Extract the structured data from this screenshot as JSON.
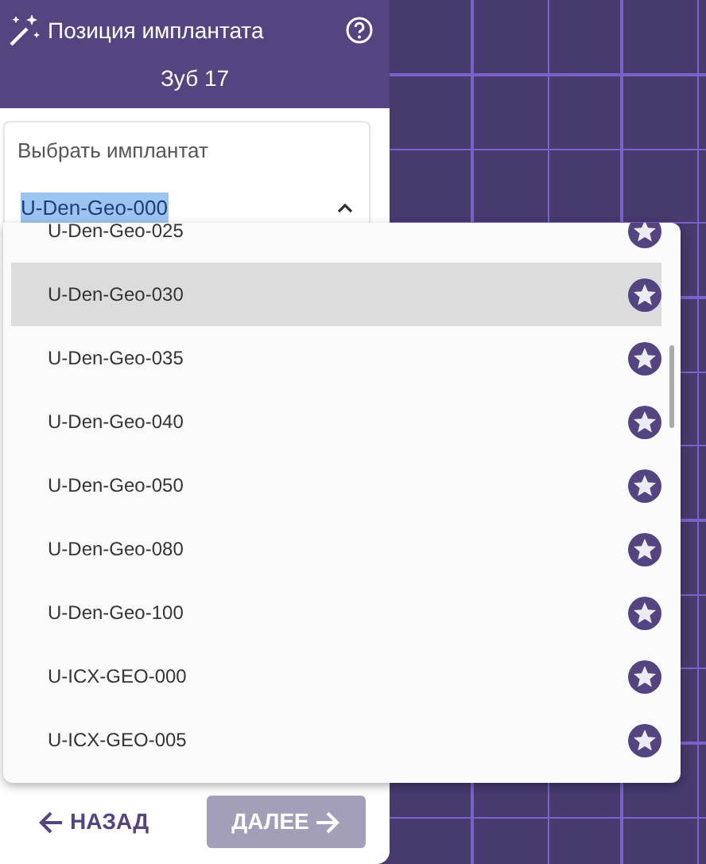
{
  "panel": {
    "title": "Позиция имплантата",
    "subtitle": "Зуб 17"
  },
  "implant_select": {
    "label": "Выбрать имплантат",
    "value": "U-Den-Geo-000",
    "expanded": true
  },
  "dropdown": {
    "items": [
      {
        "label": "U-Den-Geo-025",
        "highlighted": false
      },
      {
        "label": "U-Den-Geo-030",
        "highlighted": true
      },
      {
        "label": "U-Den-Geo-035",
        "highlighted": false
      },
      {
        "label": "U-Den-Geo-040",
        "highlighted": false
      },
      {
        "label": "U-Den-Geo-050",
        "highlighted": false
      },
      {
        "label": "U-Den-Geo-080",
        "highlighted": false
      },
      {
        "label": "U-Den-Geo-100",
        "highlighted": false
      },
      {
        "label": "U-ICX-GEO-000",
        "highlighted": false
      },
      {
        "label": "U-ICX-GEO-005",
        "highlighted": false
      }
    ]
  },
  "buttons": [
    {
      "label": "НАЗАД",
      "kind": "back",
      "disabled": false
    },
    {
      "label": "ДАЛЕЕ",
      "kind": "next",
      "disabled": true
    }
  ]
}
